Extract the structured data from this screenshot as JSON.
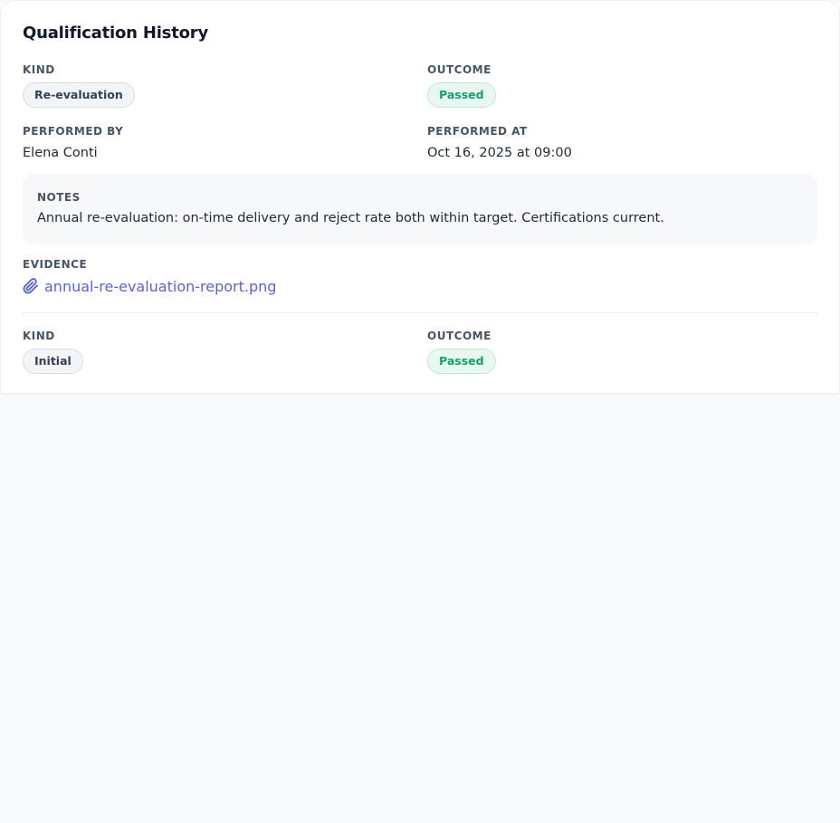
{
  "panel": {
    "title": "Qualification History"
  },
  "entries": [
    {
      "kind_label": "KIND",
      "kind": "Re-evaluation",
      "outcome_label": "OUTCOME",
      "outcome": "Passed",
      "performed_by_label": "PERFORMED BY",
      "performed_by": "Elena Conti",
      "performed_at_label": "PERFORMED AT",
      "performed_at": "Oct 16, 2025 at 09:00",
      "notes_label": "NOTES",
      "notes": "Annual re-evaluation: on-time delivery and reject rate both within target. Certifications current.",
      "evidence_label": "EVIDENCE",
      "evidence_file": "annual-re-evaluation-report.png"
    },
    {
      "kind_label": "KIND",
      "kind": "Initial",
      "outcome_label": "OUTCOME",
      "outcome": "Passed"
    }
  ],
  "icons": {
    "evidence": "paperclip-icon"
  },
  "colors": {
    "link": "#5b63d3",
    "passed_text": "#12a36a",
    "passed_bg": "#e8f8f0"
  }
}
